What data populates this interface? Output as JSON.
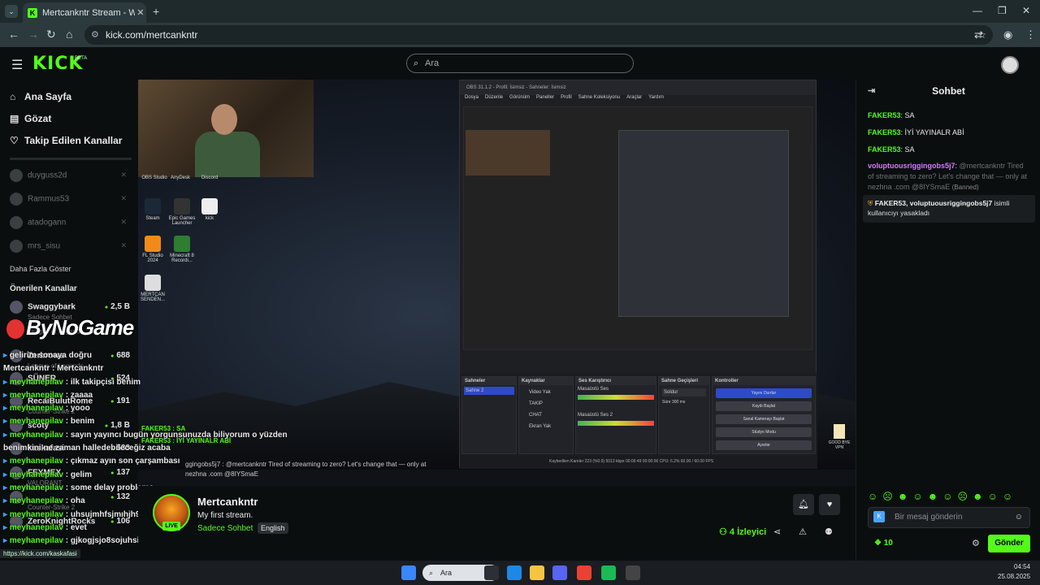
{
  "browser": {
    "tab_title": "Mertcankntr Stream - Watch Li",
    "url": "kick.com/mertcankntr",
    "status_url": "https://kick.com/kaskafasi"
  },
  "header": {
    "logo": "KICK",
    "beta": "BETA",
    "search_placeholder": "Ara"
  },
  "sidebar": {
    "nav": [
      {
        "label": "Ana Sayfa",
        "icon": "home-icon"
      },
      {
        "label": "Gözat",
        "icon": "browse-icon"
      },
      {
        "label": "Takip Edilen Kanallar",
        "icon": "heart-icon"
      }
    ],
    "followed": [
      "duyguss2d",
      "Rammus53",
      "atadogann",
      "mrs_sisu"
    ],
    "more_label": "Daha Fazla Göster",
    "recommended_heading": "Önerilen Kanallar",
    "recommended": [
      {
        "name": "Swaggybark",
        "count": "2,5 B",
        "sub": "Sadece Sohbet"
      },
      {
        "name": "Zerbrows",
        "count": "688",
        "sub": "League of Legends"
      },
      {
        "name": "SÜNER",
        "count": "524",
        "sub": ""
      },
      {
        "name": "RecaiBulutRome",
        "count": "191",
        "sub": "Counter-Strike 2"
      },
      {
        "name": "scoty",
        "count": "1,8 B",
        "sub": ""
      },
      {
        "name": "kaskafasi",
        "count": "533",
        "sub": ""
      },
      {
        "name": "FEYMEX",
        "count": "137",
        "sub": "VALORANT"
      },
      {
        "name": "",
        "count": "132",
        "sub": "Counter-Strike 2"
      },
      {
        "name": "ZeroKnightRocks",
        "count": "106",
        "sub": ""
      }
    ]
  },
  "video": {
    "overlay_logo": "ByNoGame",
    "webcam_labels": [
      "OBS Studio",
      "AnyDesk",
      "Discord"
    ],
    "desktop_icons": [
      "Steam",
      "Epic Games Launcher",
      "kick",
      "FL Studio 2024",
      "Minecraft 8 Recordi...",
      "MERTCAN SENDEN..."
    ],
    "obs": {
      "title": "OBS 31.1.2 - Profil: İsimsiz - Sahneler: İsimsiz",
      "menu": [
        "Dosya",
        "Düzenle",
        "Görünüm",
        "Paneller",
        "Profil",
        "Sahne Koleksiyonu",
        "Araçlar",
        "Yardım"
      ],
      "docks": [
        "Sahneler",
        "Kaynaklar",
        "Ses Karıştırıcı",
        "Sahne Geçişleri",
        "Kontroller"
      ],
      "scene": "Sahne 2",
      "sources": [
        "Video Yak",
        "TAKIP",
        "CHAT",
        "Ekran Yak"
      ],
      "mixer": [
        "Masaüstü Ses",
        "Masaüstü Ses 2"
      ],
      "transition": "Soldur",
      "duration_label": "Süre",
      "duration": "300 ms",
      "controls": [
        "Yayını Durdur",
        "Kaydı Başlat",
        "Sanal Kamerayı Başlat",
        "Stüdyo Modu",
        "Ayarlar"
      ],
      "status": "Kaybedilen Kareler 223 (%0.9)    5013 kbps    00:06:49    00:00:00    CPU: 6.2%    60.00 / 60.00 FPS"
    },
    "overlay_chat": [
      {
        "name": "",
        "text": "gelirim sonaya doğru"
      },
      {
        "name": "Mertcankntr",
        "text": "Mertcankntr"
      },
      {
        "name": "meyhanepilav",
        "text": "ilk takipçisi benim"
      },
      {
        "name": "meyhanepilav",
        "text": "zaaaa"
      },
      {
        "name": "meyhanepilav",
        "text": "yooo"
      },
      {
        "name": "meyhanepilav",
        "text": "benim"
      },
      {
        "name": "meyhanepilav",
        "text": "sayın yayıncı bugün yorgunsunuzda biliyorum o yüzden"
      },
      {
        "name": "",
        "text": "benimkini ne zaman halledebileceğiz acaba"
      },
      {
        "name": "meyhanepilav",
        "text": "çıkmaz ayın son çarşambası"
      },
      {
        "name": "meyhanepilav",
        "text": "gelim"
      },
      {
        "name": "meyhanepilav",
        "text": "some delay problems"
      },
      {
        "name": "meyhanepilav",
        "text": "oha"
      },
      {
        "name": "meyhanepilav",
        "text": "uhsujmhfsjmıhjh90skısh90hsf"
      },
      {
        "name": "meyhanepilav",
        "text": "evet"
      },
      {
        "name": "meyhanepilav",
        "text": "gjkogjsjo8sojuhsijshjushjıhs"
      }
    ],
    "overlay_mid": [
      "FAKER53 : SA",
      "FAKER53 : İYİ YAYINALR ABİ",
      "ggingobs5j7 : @mertcankntr Tired of streaming to zero? Let's change that — only at nezhna .com @8IYSmaE"
    ],
    "tray_label": "GOOD BYE VPN"
  },
  "stream_info": {
    "channel": "Mertcankntr",
    "title": "My first stream.",
    "category": "Sadece Sohbet",
    "language": "English",
    "live": "LIVE",
    "viewers": "4",
    "viewers_label": "İzleyici"
  },
  "chat": {
    "title": "Sohbet",
    "messages": [
      {
        "user": "FAKER53",
        "text": "SA"
      },
      {
        "user": "FAKER53",
        "text": "İYİ YAYINALR ABİ"
      },
      {
        "user": "FAKER53",
        "text": "SA"
      }
    ],
    "spam": {
      "user": "voluptuousriggingobs5j7",
      "text": "@mertcankntr Tired of streaming to zero? Let's change that — only at nezhna .com @8IYSmaE",
      "tag": "(Banned)"
    },
    "ban_notice": {
      "actors": "FAKER53, voluptuousriggingobs5j7",
      "text": "isimli kullanıcıyı yasakladı"
    },
    "input_placeholder": "Bir mesaj gönderin",
    "points": "10",
    "send_label": "Gönder"
  },
  "taskbar": {
    "search_label": "Ara",
    "time": "04:54",
    "date": "25.08.2025"
  },
  "colors": {
    "accent": "#53fc18",
    "background": "#0b0e0f",
    "spam_user": "#d77aff"
  }
}
